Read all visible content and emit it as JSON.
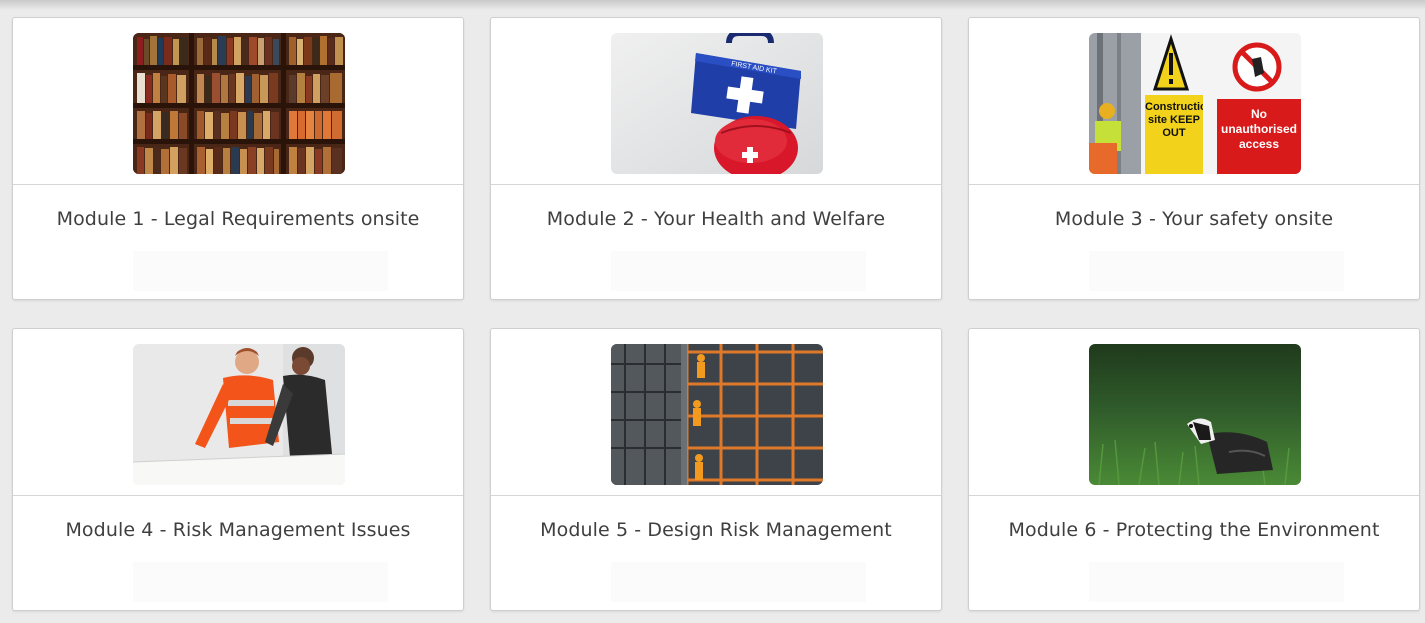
{
  "modules": [
    {
      "title": "Module 1 - Legal Requirements onsite",
      "image": "bookshelf-photo"
    },
    {
      "title": "Module 2 - Your Health and Welfare",
      "image": "first-aid-kit-photo",
      "image_text": "FIRST AID KIT"
    },
    {
      "title": "Module 3 - Your safety onsite",
      "image": "construction-signs-photo",
      "image_text": [
        "Construction site KEEP OUT",
        "No unauthorised access"
      ]
    },
    {
      "title": "Module 4 - Risk Management Issues",
      "image": "workers-reviewing-plans-photo"
    },
    {
      "title": "Module 5 - Design Risk Management",
      "image": "scaffolding-workers-photo"
    },
    {
      "title": "Module 6 - Protecting the Environment",
      "image": "badger-in-grass-photo"
    }
  ],
  "colors": {
    "card_border": "#cfcfcf",
    "title_text": "#3f3f3f",
    "background": "#ebebeb"
  }
}
